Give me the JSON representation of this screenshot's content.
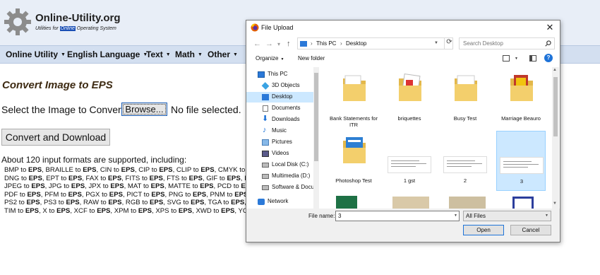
{
  "site": {
    "title": "Online-Utility.org",
    "tagline_pre": "Utilities for ",
    "tagline_highlight": "Online",
    "tagline_post": " Operating System",
    "logo_icon": "gear-icon"
  },
  "nav": {
    "items": [
      "Online Utility",
      "English Language",
      "Text",
      "Math",
      "Other"
    ]
  },
  "main": {
    "heading": "Convert Image to EPS",
    "select_label": "Select the Image to Convert:",
    "browse_label": "Browse...",
    "no_file": "No file selected.",
    "convert_label": "Convert and Download",
    "formats_intro": "About 120 input formats are supported, including:",
    "format_lines": [
      "BMP to EPS, BRAILLE to EPS, CIN to EPS, CIP to EPS, CLIP to EPS, CMYK to EPS",
      "DNG to EPS, EPT to EPS, FAX to EPS, FITS to EPS, FTS to EPS, GIF to EPS, ICO",
      "JPEG to EPS, JPG to EPS, JPX to EPS, MAT to EPS, MATTE to EPS, PCD to EPS",
      "PDF to EPS, PFM to EPS, PGX to EPS, PICT to EPS, PNG to EPS, PNM to EPS, PS",
      "PS2 to EPS, PS3 to EPS, RAW to EPS, RGB to EPS, SVG to EPS, TGA to EPS, TIF",
      "TIM to EPS, X to EPS, XCF to EPS, XPM to EPS, XPS to EPS, XWD to EPS, YCbCr"
    ]
  },
  "dialog": {
    "title": "File Upload",
    "close_glyph": "✕",
    "breadcrumb": [
      "This PC",
      "Desktop"
    ],
    "search_placeholder": "Search Desktop",
    "organize_label": "Organize",
    "new_folder_label": "New folder",
    "help_glyph": "?",
    "tree": [
      {
        "label": "This PC",
        "icon": "computer-icon",
        "selected": false
      },
      {
        "label": "3D Objects",
        "icon": "cube-icon",
        "selected": false
      },
      {
        "label": "Desktop",
        "icon": "desktop-icon",
        "selected": true
      },
      {
        "label": "Documents",
        "icon": "document-icon",
        "selected": false
      },
      {
        "label": "Downloads",
        "icon": "download-icon",
        "selected": false
      },
      {
        "label": "Music",
        "icon": "music-icon",
        "selected": false
      },
      {
        "label": "Pictures",
        "icon": "pictures-icon",
        "selected": false
      },
      {
        "label": "Videos",
        "icon": "video-icon",
        "selected": false
      },
      {
        "label": "Local Disk (C:)",
        "icon": "drive-icon",
        "selected": false
      },
      {
        "label": "Multimedia (D:)",
        "icon": "drive-icon",
        "selected": false
      },
      {
        "label": "Software & Docu",
        "icon": "drive-icon",
        "selected": false
      },
      {
        "label": "Network",
        "icon": "network-icon",
        "selected": false
      }
    ],
    "files": [
      {
        "label": "Bank Statements for ITR",
        "kind": "folder",
        "selected": false
      },
      {
        "label": "briquettes",
        "kind": "folder",
        "selected": false
      },
      {
        "label": "Busy Test",
        "kind": "folder",
        "selected": false
      },
      {
        "label": "Marriage Beauro",
        "kind": "folder",
        "selected": false
      },
      {
        "label": "Photoshop Test",
        "kind": "folder",
        "selected": false
      },
      {
        "label": "1 gst",
        "kind": "document",
        "selected": false
      },
      {
        "label": "2",
        "kind": "document",
        "selected": false
      },
      {
        "label": "3",
        "kind": "document",
        "selected": true
      }
    ],
    "file_name_label": "File name:",
    "file_name_value": "3",
    "filter_value": "All Files",
    "open_label": "Open",
    "cancel_label": "Cancel",
    "accent_color": "#1e73d8",
    "folder_color": "#f3cf6c"
  }
}
